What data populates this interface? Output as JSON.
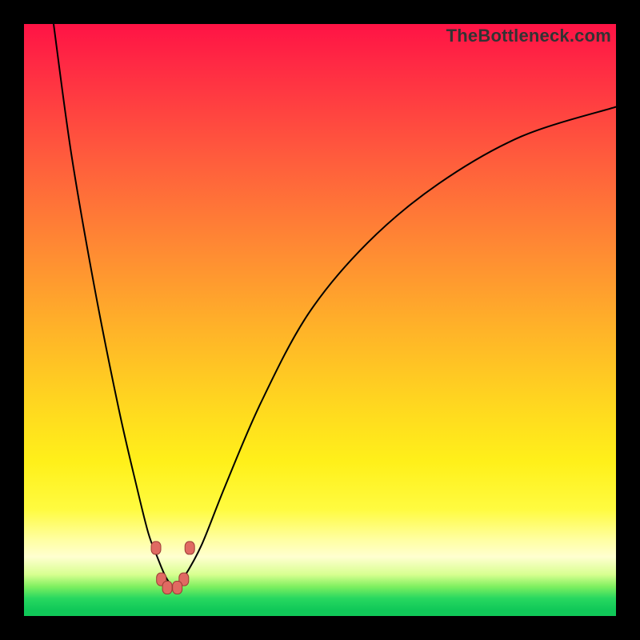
{
  "watermark": {
    "text": "TheBottleneck.com"
  },
  "colors": {
    "frame": "#000000",
    "curve_stroke": "#000000",
    "marker_fill": "#e06a62",
    "marker_stroke": "#9c3d36"
  },
  "chart_data": {
    "type": "line",
    "title": "",
    "xlabel": "",
    "ylabel": "",
    "xlim": [
      0,
      100
    ],
    "ylim": [
      0,
      100
    ],
    "grid": false,
    "series": [
      {
        "name": "bottleneck-curve",
        "x": [
          5,
          8,
          12,
          16,
          19,
          21,
          22.5,
          24,
          25.5,
          27,
          30,
          34,
          40,
          48,
          58,
          70,
          84,
          100
        ],
        "y": [
          100,
          78,
          55,
          35,
          22,
          14,
          10,
          6.5,
          4.8,
          6.5,
          12,
          22,
          36,
          51,
          63,
          73,
          81,
          86
        ]
      }
    ],
    "annotations": [
      {
        "name": "marker",
        "x": 22.3,
        "y": 11.5
      },
      {
        "name": "marker",
        "x": 28.0,
        "y": 11.5
      },
      {
        "name": "marker",
        "x": 23.2,
        "y": 6.2
      },
      {
        "name": "marker",
        "x": 27.0,
        "y": 6.2
      },
      {
        "name": "marker",
        "x": 24.2,
        "y": 4.8
      },
      {
        "name": "marker",
        "x": 25.9,
        "y": 4.8
      }
    ]
  }
}
